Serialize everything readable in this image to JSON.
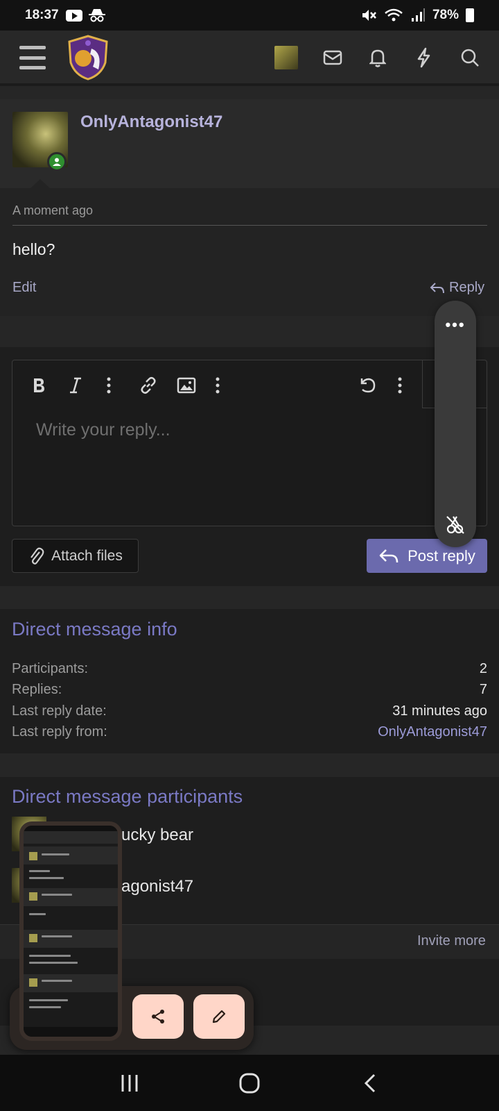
{
  "status_bar": {
    "time": "18:37",
    "battery": "78%"
  },
  "header": {
    "logo_name": "site-logo",
    "icons": [
      "menu-icon",
      "avatar",
      "mail-icon",
      "bell-icon",
      "bolt-icon",
      "search-icon"
    ]
  },
  "post": {
    "username": "OnlyAntagonist47",
    "timestamp": "A moment ago",
    "message": "hello?",
    "edit_label": "Edit",
    "reply_label": "Reply"
  },
  "editor": {
    "placeholder": "Write your reply...",
    "toolbar": [
      "bold-icon",
      "italic-icon",
      "more-icon",
      "link-icon",
      "image-icon",
      "more-icon",
      "undo-icon",
      "more-icon",
      "preview-icon"
    ],
    "attach_label": "Attach files",
    "post_reply_label": "Post reply"
  },
  "floating_panel": {
    "dots": "•••"
  },
  "info": {
    "title": "Direct message info",
    "rows": [
      {
        "label": "Participants:",
        "value": "2"
      },
      {
        "label": "Replies:",
        "value": "7"
      },
      {
        "label": "Last reply date:",
        "value": "31 minutes ago"
      },
      {
        "label": "Last reply from:",
        "value": "OnlyAntagonist47"
      }
    ]
  },
  "participants": {
    "title": "Direct message participants",
    "names_visible": [
      "ucky bear",
      "agonist47"
    ],
    "invite_label": "Invite more"
  },
  "colors": {
    "accent": "#6b6aad",
    "link": "#7a79c4",
    "online": "#2f8f2f",
    "chip": "#ffd6c8"
  }
}
